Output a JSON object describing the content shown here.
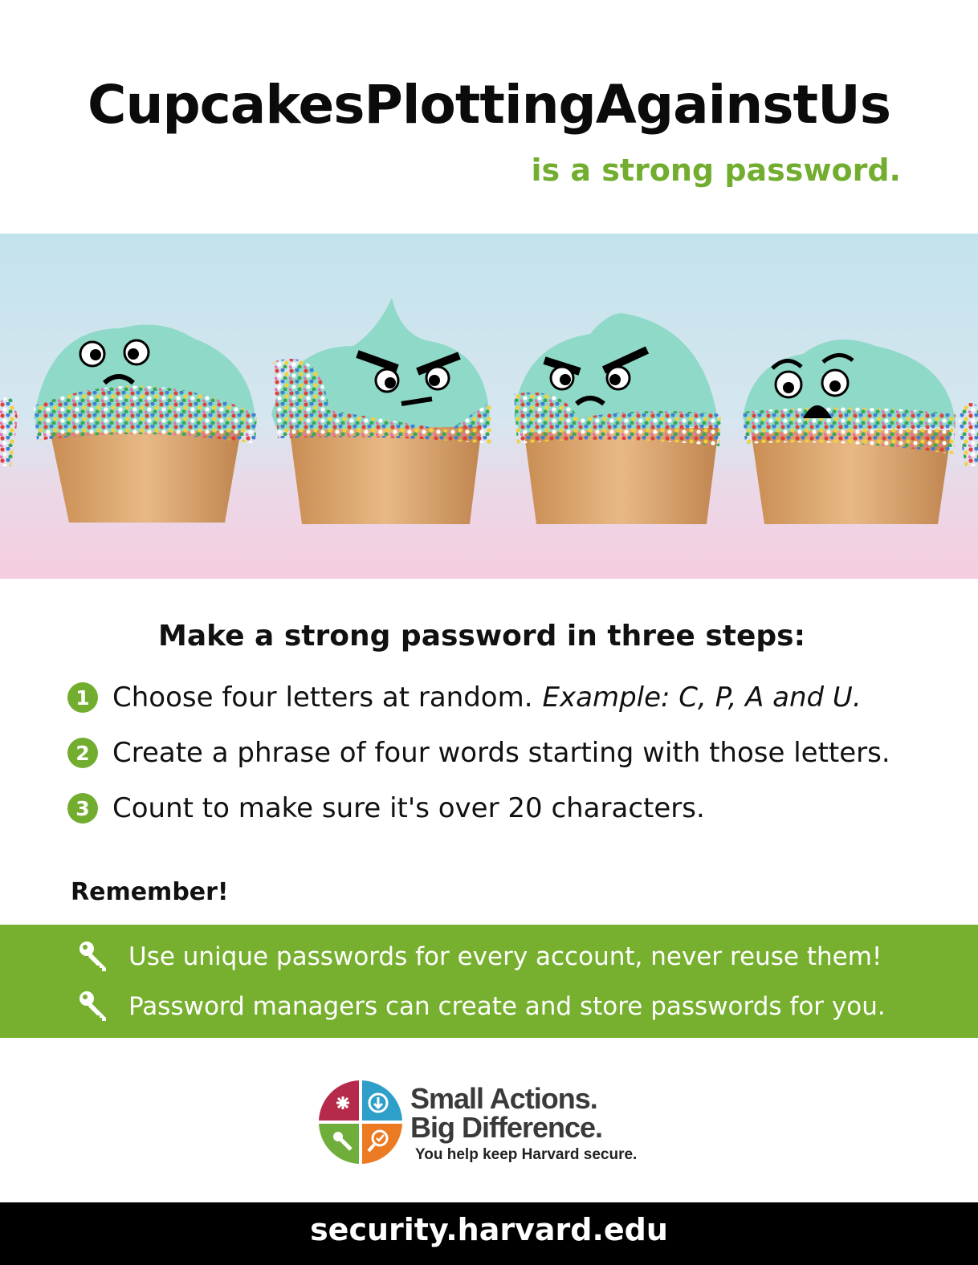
{
  "headline": "CupcakesPlottingAgainstUs",
  "subhead": "is a strong password.",
  "steps_title": "Make a strong password in three steps:",
  "steps": [
    {
      "number": "1",
      "text": "Choose four letters at random.",
      "example": "Example: C, P, A and U."
    },
    {
      "number": "2",
      "text": "Create a phrase of four words starting with those letters.",
      "example": ""
    },
    {
      "number": "3",
      "text": "Count to make sure it's over 20 characters.",
      "example": ""
    }
  ],
  "remember_label": "Remember!",
  "tips": [
    {
      "icon": "key-icon",
      "text": "Use unique passwords for every account, never reuse them!"
    },
    {
      "icon": "key-icon",
      "text": "Password managers can create and store passwords for you."
    }
  ],
  "logo": {
    "line1": "Small Actions.",
    "line2": "Big Difference.",
    "line3": "You help keep Harvard secure."
  },
  "footer_url": "security.harvard.edu",
  "colors": {
    "accent_green": "#72ad2f",
    "band_green": "#77b02f",
    "frosting": "#8fd9c8",
    "footer_bg": "#000000"
  }
}
